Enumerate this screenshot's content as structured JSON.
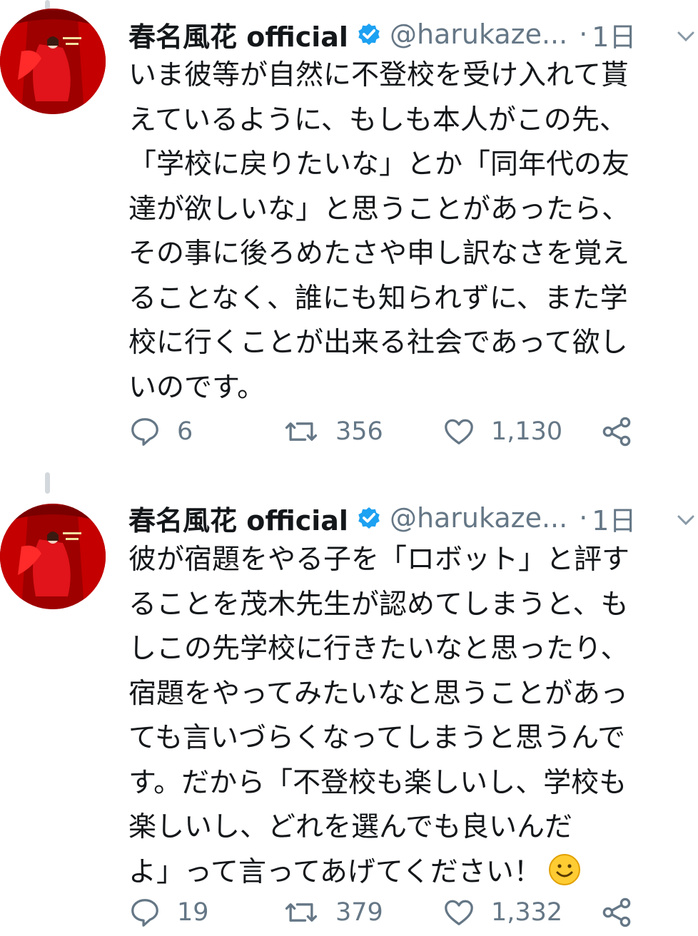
{
  "tweets": [
    {
      "author_name": "春名風花 official",
      "handle": "@harukaze...",
      "separator": "·",
      "time": "1日",
      "lines": [
        "いま彼等が自然に不登校を受け入れて貰",
        "えているように、もしも本人がこの先、",
        "「学校に戻りたいな」とか「同年代の友",
        "達が欲しいな」と思うことがあったら、",
        "その事に後ろめたさや申し訳なさを覚え",
        "ることなく、誰にも知られずに、また学",
        "校に行くことが出来る社会であって欲し",
        "いのです。"
      ],
      "replies": "6",
      "retweets": "356",
      "likes": "1,130"
    },
    {
      "author_name": "春名風花 official",
      "handle": "@harukaze...",
      "separator": "·",
      "time": "1日",
      "lines": [
        "彼が宿題をやる子を「ロボット」と評す",
        "ることを茂木先生が認めてしまうと、も",
        "しこの先学校に行きたいなと思ったり、",
        "宿題をやってみたいなと思うことがあっ",
        "ても言いづらくなってしまうと思うんで",
        "す。だから「不登校も楽しいし、学校も",
        "楽しいし、どれを選んでも良いんだ",
        "よ」って言ってあげてください！"
      ],
      "replies": "19",
      "retweets": "379",
      "likes": "1,332"
    }
  ],
  "icons": {
    "verified": "verified-badge-icon",
    "chevron": "chevron-down-icon",
    "reply": "reply-icon",
    "retweet": "retweet-icon",
    "like": "heart-icon",
    "share": "share-icon",
    "emoji": "smiling-face-icon"
  },
  "colors": {
    "text": "#14171a",
    "secondary": "#657786",
    "verified_blue": "#1da1f2",
    "thread_line": "#d3d8dc",
    "emoji_yellow": "#ffcc33"
  }
}
